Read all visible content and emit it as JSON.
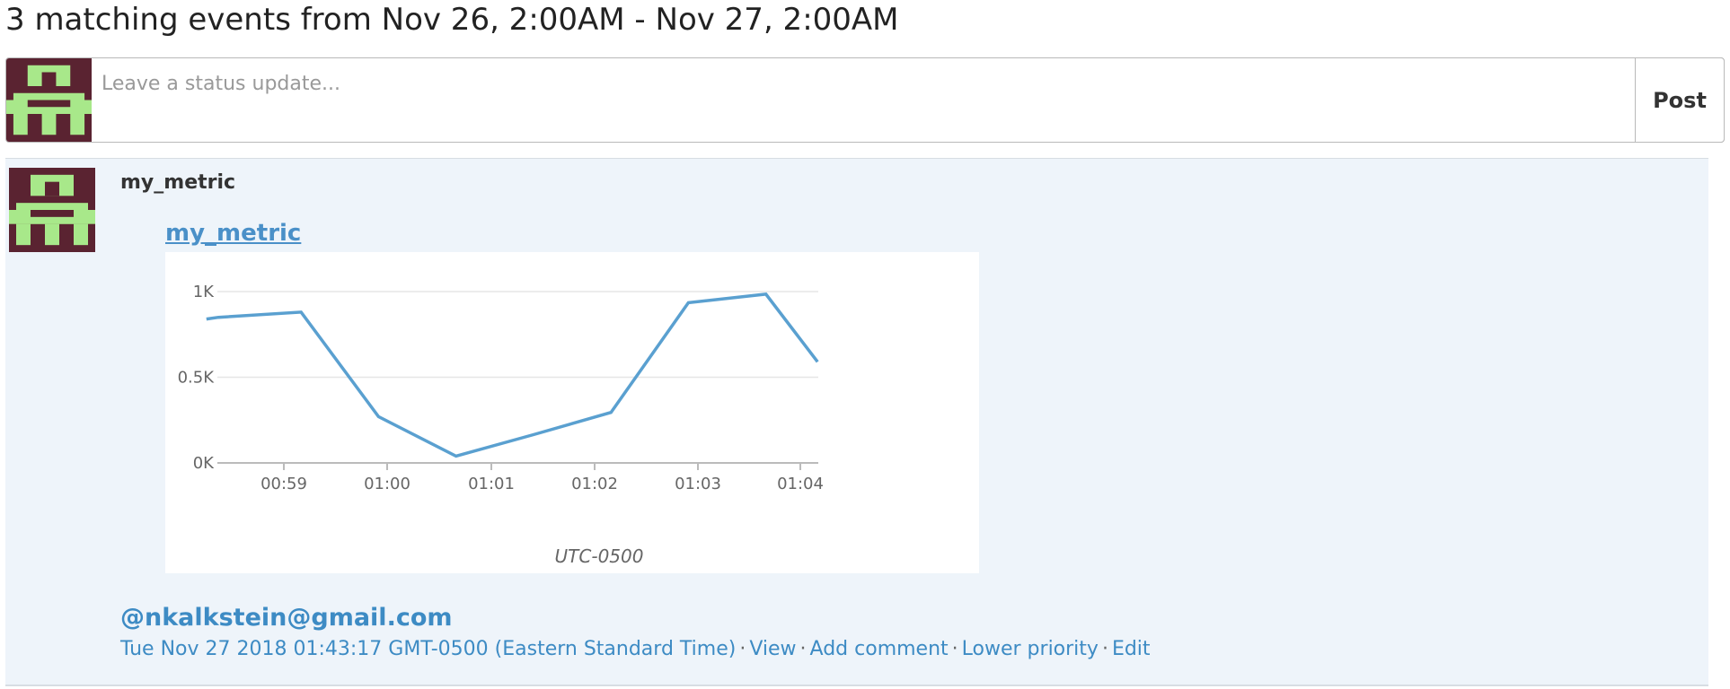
{
  "header": {
    "title": "3 matching events from Nov 26, 2:00AM - Nov 27, 2:00AM"
  },
  "status": {
    "placeholder": "Leave a status update...",
    "post_label": "Post"
  },
  "event": {
    "author": "my_metric",
    "metric_link": "my_metric",
    "mention": "@nkalkstein@gmail.com",
    "timestamp": "Tue Nov 27 2018 01:43:17 GMT-0500 (Eastern Standard Time)",
    "actions": {
      "view": "View",
      "add_comment": "Add comment",
      "lower_priority": "Lower priority",
      "edit": "Edit"
    }
  },
  "colors": {
    "avatar_bg": "#5a2331",
    "avatar_fg": "#a8e88a",
    "link": "#3d8bc4",
    "line": "#5aa0d0",
    "event_bg": "#eef4fa"
  },
  "chart_data": {
    "type": "line",
    "xlabel": "UTC-0500",
    "ylabel": "",
    "grid": true,
    "yticks": [
      "1K",
      "0.5K",
      "0K"
    ],
    "xticks": [
      "00:59",
      "01:00",
      "01:01",
      "01:02",
      "01:03",
      "01:04"
    ],
    "ylim": [
      0,
      1000
    ],
    "series": [
      {
        "x": [
          "00:58:15",
          "00:58:22",
          "00:59:10",
          "00:59:55",
          "01:00:40",
          "01:01:25",
          "01:02:10",
          "01:02:55",
          "01:03:40",
          "01:04:10"
        ],
        "values": [
          840,
          850,
          880,
          270,
          40,
          165,
          295,
          935,
          985,
          590
        ]
      }
    ]
  }
}
